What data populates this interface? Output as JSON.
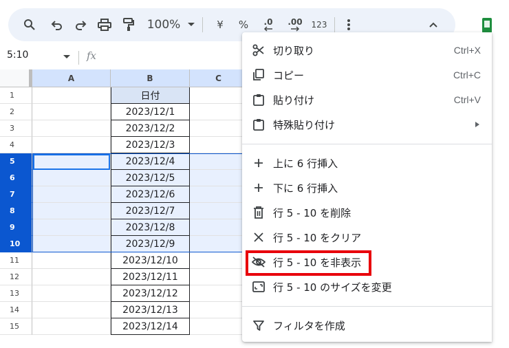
{
  "toolbar": {
    "zoom": "100%",
    "currency_symbol": "¥",
    "percent_symbol": "%",
    "decrease_decimal": ".0",
    "increase_decimal": ".00",
    "number_format": "123"
  },
  "formula_bar": {
    "name_box": "5:10",
    "fx_label": "fx"
  },
  "columns": [
    "A",
    "B",
    "C"
  ],
  "rows": [
    {
      "num": "1",
      "b": "日付",
      "selected": false,
      "header": true
    },
    {
      "num": "2",
      "b": "2023/12/1",
      "selected": false
    },
    {
      "num": "3",
      "b": "2023/12/2",
      "selected": false
    },
    {
      "num": "4",
      "b": "2023/12/3",
      "selected": false
    },
    {
      "num": "5",
      "b": "2023/12/4",
      "selected": true
    },
    {
      "num": "6",
      "b": "2023/12/5",
      "selected": true
    },
    {
      "num": "7",
      "b": "2023/12/6",
      "selected": true
    },
    {
      "num": "8",
      "b": "2023/12/7",
      "selected": true
    },
    {
      "num": "9",
      "b": "2023/12/8",
      "selected": true
    },
    {
      "num": "10",
      "b": "2023/12/9",
      "selected": true
    },
    {
      "num": "11",
      "b": "2023/12/10",
      "selected": false
    },
    {
      "num": "12",
      "b": "2023/12/11",
      "selected": false
    },
    {
      "num": "13",
      "b": "2023/12/12",
      "selected": false
    },
    {
      "num": "14",
      "b": "2023/12/13",
      "selected": false
    },
    {
      "num": "15",
      "b": "2023/12/14",
      "selected": false
    }
  ],
  "context_menu": {
    "cut": {
      "label": "切り取り",
      "shortcut": "Ctrl+X"
    },
    "copy": {
      "label": "コピー",
      "shortcut": "Ctrl+C"
    },
    "paste": {
      "label": "貼り付け",
      "shortcut": "Ctrl+V"
    },
    "paste_special": {
      "label": "特殊貼り付け"
    },
    "insert_above": {
      "label": "上に 6 行挿入"
    },
    "insert_below": {
      "label": "下に 6 行挿入"
    },
    "delete_rows": {
      "label": "行 5 - 10 を削除"
    },
    "clear_rows": {
      "label": "行 5 - 10 をクリア"
    },
    "hide_rows": {
      "label": "行 5 - 10 を非表示"
    },
    "resize_rows": {
      "label": "行 5 - 10 のサイズを変更"
    },
    "create_filter": {
      "label": "フィルタを作成"
    }
  },
  "colors": {
    "selection_blue": "#0b57d0",
    "selection_fill": "#e8f0fe",
    "highlight_red": "#e8000b"
  }
}
